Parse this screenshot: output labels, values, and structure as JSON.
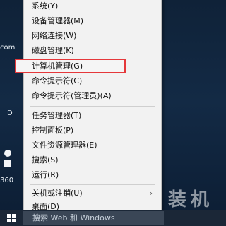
{
  "desktop": {
    "fragments": [
      "com",
      "D",
      "360"
    ],
    "watermark": "装机"
  },
  "context_menu": {
    "items": [
      "系统(Y)",
      "设备管理器(M)",
      "网络连接(W)",
      "磁盘管理(K)",
      "计算机管理(G)",
      "命令提示符(C)",
      "命令提示符(管理员)(A)",
      "任务管理器(T)",
      "控制面板(P)",
      "文件资源管理器(E)",
      "搜索(S)",
      "运行(R)",
      "关机或注销(U)",
      "桌面(D)"
    ],
    "highlighted_item": "计算机管理(G)",
    "submenu_chevron": "›"
  },
  "taskbar": {
    "search_text": "搜索 Web 和 Windows"
  },
  "colors": {
    "highlight_border": "#e5383b",
    "menu_background": "#f2f2f2",
    "desktop_background": "#132a45"
  }
}
